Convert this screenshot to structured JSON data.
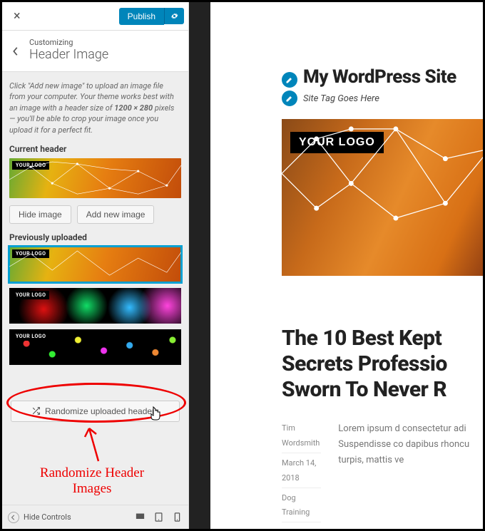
{
  "topbar": {
    "publish": "Publish"
  },
  "breadcrumb": {
    "small": "Customizing",
    "title": "Header Image"
  },
  "description": {
    "pre": "Click \"Add new image\" to upload an image file from your computer. Your theme works best with an image with a header size of ",
    "dims": "1200 × 280",
    "post": " pixels — you'll be able to crop your image once you upload it for a perfect fit."
  },
  "labels": {
    "current": "Current header",
    "previous": "Previously uploaded",
    "hide_image": "Hide image",
    "add_new": "Add new image",
    "randomize": "Randomize uploaded headers",
    "hide_controls": "Hide Controls",
    "logo_badge": "YOUR LOGO"
  },
  "preview": {
    "site_title": "My WordPress Site",
    "site_tag": "Site Tag Goes Here",
    "headline": "The 10 Best Kept Secrets Professio Sworn To Never R",
    "meta": {
      "author": "Tim Wordsmith",
      "date": "March 14, 2018",
      "category": "Dog Training"
    },
    "body": "Lorem ipsum d consectetur adi Suspendisse co dapibus rhoncu turpis, mattis ve"
  },
  "annotation": {
    "caption": "Randomize Header Images"
  }
}
